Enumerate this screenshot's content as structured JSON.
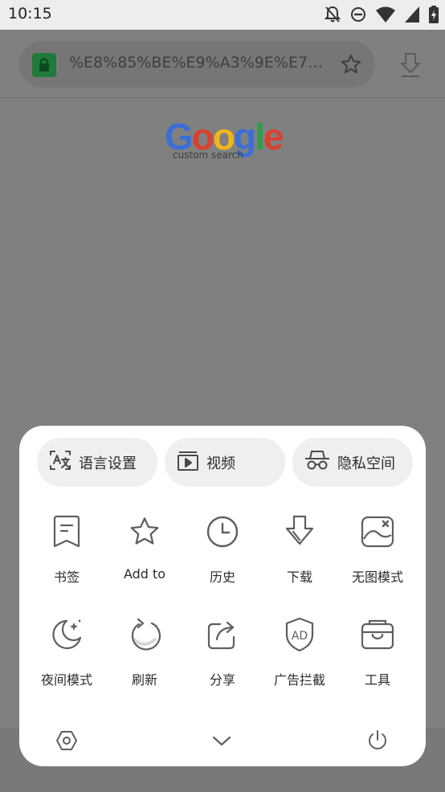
{
  "status_bar": {
    "time": "10:15",
    "icons": [
      "notifications-off-icon",
      "do-not-disturb-icon",
      "wifi-icon",
      "cellular-signal-icon",
      "battery-charging-icon"
    ]
  },
  "browser": {
    "url": "%E8%85%BE%E9%A3%9E%E7%B...",
    "logo_text": "Google",
    "logo_subtext": "custom search"
  },
  "menu": {
    "chips": [
      {
        "label": "语言设置",
        "icon": "translate-icon"
      },
      {
        "label": "视频",
        "icon": "video-icon"
      },
      {
        "label": "隐私空间",
        "icon": "incognito-icon"
      }
    ],
    "row1": [
      {
        "label": "书签",
        "icon": "bookmark-icon"
      },
      {
        "label": "Add to",
        "icon": "star-icon"
      },
      {
        "label": "历史",
        "icon": "history-clock-icon"
      },
      {
        "label": "下载",
        "icon": "download-icon"
      },
      {
        "label": "无图模式",
        "icon": "no-image-icon"
      }
    ],
    "row2": [
      {
        "label": "夜间模式",
        "icon": "night-mode-moon-icon"
      },
      {
        "label": "刷新",
        "icon": "refresh-icon"
      },
      {
        "label": "分享",
        "icon": "share-icon"
      },
      {
        "label": "广告拦截",
        "icon": "ad-block-shield-icon"
      },
      {
        "label": "工具",
        "icon": "toolbox-icon"
      }
    ],
    "bottom_icons": [
      "settings-hexagon-icon",
      "collapse-chevron-icon",
      "power-exit-icon"
    ]
  },
  "colors": {
    "accent_green": "#1f7a3b",
    "icon_gray": "#5f5f5f",
    "google_blue": "#3b6fd6",
    "google_red": "#d9412f",
    "google_yellow": "#f1b51c",
    "google_green": "#2e9e4a"
  }
}
